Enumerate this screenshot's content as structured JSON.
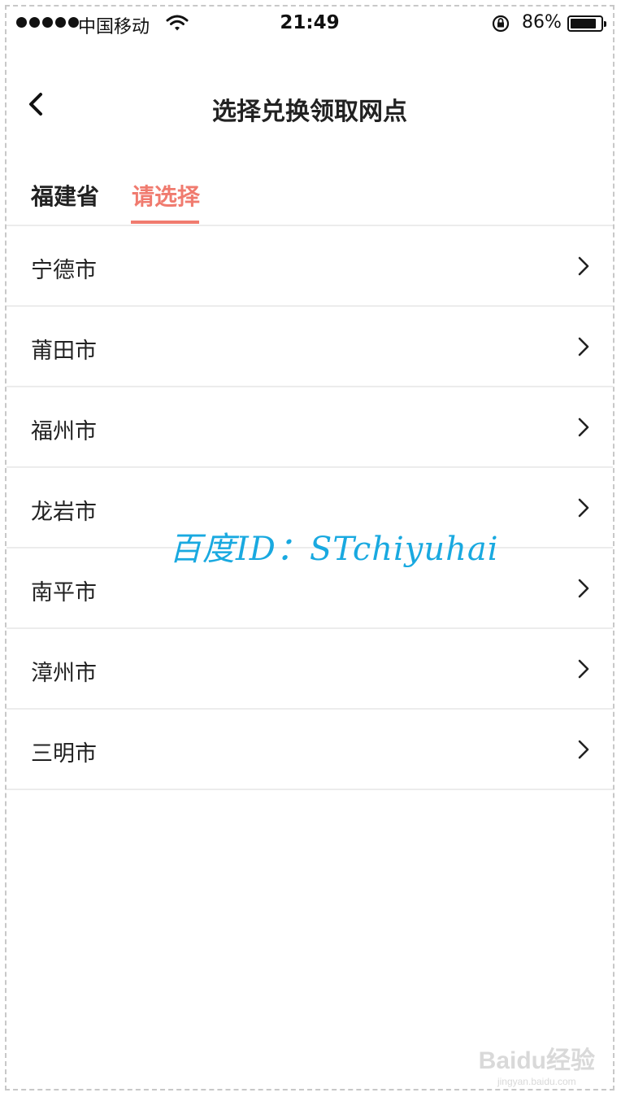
{
  "status_bar": {
    "carrier": "中国移动",
    "time": "21:49",
    "battery_percent": "86%",
    "battery_level": 0.86,
    "signal_dots": 5
  },
  "nav": {
    "title": "选择兑换领取网点",
    "back_icon": "chevron-left-icon"
  },
  "tabs": {
    "province": "福建省",
    "select": "请选择",
    "active_color": "#f07b6f"
  },
  "cities": [
    {
      "label": "宁德市"
    },
    {
      "label": "莆田市"
    },
    {
      "label": "福州市"
    },
    {
      "label": "龙岩市"
    },
    {
      "label": "南平市"
    },
    {
      "label": "漳州市"
    },
    {
      "label": "三明市"
    }
  ],
  "watermark": {
    "text": "百度ID：STchiyuhai",
    "baidu_logo": "Baidu经验",
    "baidu_url": "jingyan.baidu.com"
  }
}
